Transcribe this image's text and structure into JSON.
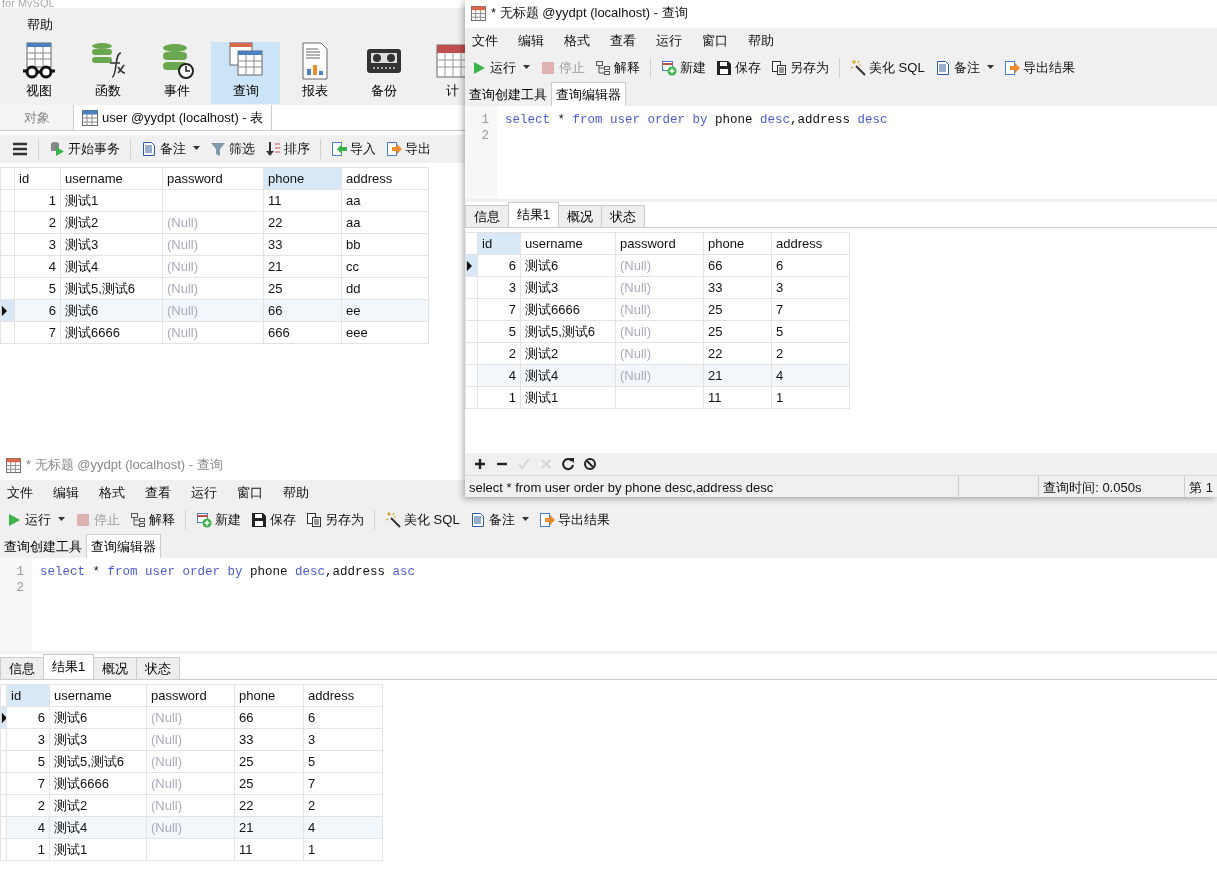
{
  "main_window": {
    "title": "for MySQL",
    "menu": [
      "帮助"
    ],
    "ribbon": [
      {
        "label": "视图",
        "kind": "view",
        "selected": false
      },
      {
        "label": "函数",
        "kind": "function",
        "selected": false
      },
      {
        "label": "事件",
        "kind": "event",
        "selected": false
      },
      {
        "label": "查询",
        "kind": "query",
        "selected": true
      },
      {
        "label": "报表",
        "kind": "report",
        "selected": false
      },
      {
        "label": "备份",
        "kind": "backup",
        "selected": false
      },
      {
        "label": "计",
        "kind": "schedule",
        "selected": false
      }
    ],
    "tabs": [
      {
        "label": "对象",
        "selected": false
      },
      {
        "label": "user @yydpt (localhost) - 表",
        "selected": true
      }
    ],
    "toolbar_groups": [
      [
        {
          "kind": "menu",
          "dropdown": false
        }
      ],
      [
        {
          "label": "开始事务",
          "kind": "transaction",
          "dropdown": false
        }
      ],
      [
        {
          "label": "备注",
          "kind": "note",
          "dropdown": true
        },
        {
          "label": "筛选",
          "kind": "filter",
          "dropdown": false
        },
        {
          "label": "排序",
          "kind": "sort",
          "dropdown": false
        }
      ],
      [
        {
          "label": "导入",
          "kind": "import",
          "dropdown": false
        },
        {
          "label": "导出",
          "kind": "export",
          "dropdown": false
        }
      ]
    ],
    "table": {
      "columns": [
        {
          "label": "id",
          "selected": false
        },
        {
          "label": "username",
          "selected": false
        },
        {
          "label": "password",
          "selected": false
        },
        {
          "label": "phone",
          "selected": true
        },
        {
          "label": "address",
          "selected": false
        }
      ],
      "rows": [
        {
          "selected": false,
          "highlighted": false,
          "cells": [
            "1",
            "测试1",
            null,
            "11",
            "aa"
          ]
        },
        {
          "selected": false,
          "highlighted": false,
          "cells": [
            "2",
            "测试2",
            {
              "text": "(Null)",
              "kind": "null"
            },
            "22",
            "aa"
          ]
        },
        {
          "selected": false,
          "highlighted": false,
          "cells": [
            "3",
            "测试3",
            {
              "text": "(Null)",
              "kind": "null"
            },
            "33",
            "bb"
          ]
        },
        {
          "selected": false,
          "highlighted": false,
          "cells": [
            "4",
            "测试4",
            {
              "text": "(Null)",
              "kind": "null"
            },
            "21",
            "cc"
          ]
        },
        {
          "selected": false,
          "highlighted": false,
          "cells": [
            "5",
            "测试5,测试6",
            {
              "text": "(Null)",
              "kind": "null"
            },
            "25",
            "dd"
          ]
        },
        {
          "selected": true,
          "highlighted": true,
          "cells": [
            "6",
            "测试6",
            {
              "text": "(Null)",
              "kind": "null"
            },
            "66",
            "ee"
          ]
        },
        {
          "selected": false,
          "highlighted": false,
          "cells": [
            "7",
            "测试6666",
            {
              "text": "(Null)",
              "kind": "null"
            },
            "666",
            "eee"
          ]
        }
      ]
    }
  },
  "query_windows": [
    {
      "title": "* 无标题 @yydpt (localhost) - 查询",
      "active": true,
      "menu": [
        "文件",
        "编辑",
        "格式",
        "查看",
        "运行",
        "窗口",
        "帮助"
      ],
      "toolbar_groups": [
        [
          {
            "label": "运行",
            "kind": "play",
            "dropdown": true,
            "disabled": false
          },
          {
            "label": "停止",
            "kind": "stop",
            "dropdown": false,
            "disabled": true
          },
          {
            "label": "解释",
            "kind": "explain",
            "dropdown": false,
            "disabled": false
          }
        ],
        [
          {
            "label": "新建",
            "kind": "new",
            "dropdown": false,
            "disabled": false
          },
          {
            "label": "保存",
            "kind": "save",
            "dropdown": false,
            "disabled": false
          },
          {
            "label": "另存为",
            "kind": "saveas",
            "dropdown": false,
            "disabled": false
          }
        ],
        [
          {
            "label": "美化 SQL",
            "kind": "beautify",
            "dropdown": false,
            "disabled": false
          },
          {
            "label": "备注",
            "kind": "note",
            "dropdown": true,
            "disabled": false
          },
          {
            "label": "导出结果",
            "kind": "export",
            "dropdown": false,
            "disabled": false
          }
        ]
      ],
      "editor_tabs": [
        {
          "label": "查询创建工具",
          "selected": false
        },
        {
          "label": "查询编辑器",
          "selected": true
        }
      ],
      "sql_lines": [
        {
          "number": "1",
          "tokens": [
            {
              "text": "select",
              "kind": "keyword"
            },
            {
              "text": " * ",
              "kind": "plain"
            },
            {
              "text": "from user order by",
              "kind": "keyword"
            },
            {
              "text": " phone ",
              "kind": "plain"
            },
            {
              "text": "desc",
              "kind": "keyword"
            },
            {
              "text": ",address ",
              "kind": "plain"
            },
            {
              "text": "desc",
              "kind": "keyword"
            }
          ]
        },
        {
          "number": "2"
        }
      ],
      "result_tabs": [
        {
          "label": "信息",
          "selected": false
        },
        {
          "label": "结果1",
          "selected": true
        },
        {
          "label": "概况",
          "selected": false
        },
        {
          "label": "状态",
          "selected": false
        }
      ],
      "table": {
        "columns": [
          {
            "label": "id",
            "selected": true
          },
          {
            "label": "username",
            "selected": false
          },
          {
            "label": "password",
            "selected": false
          },
          {
            "label": "phone",
            "selected": false
          },
          {
            "label": "address",
            "selected": false
          }
        ],
        "rows": [
          {
            "selected": true,
            "highlighted": false,
            "cells": [
              "6",
              "测试6",
              {
                "text": "(Null)",
                "kind": "null"
              },
              "66",
              "6"
            ]
          },
          {
            "selected": false,
            "highlighted": false,
            "cells": [
              "3",
              "测试3",
              {
                "text": "(Null)",
                "kind": "null"
              },
              "33",
              "3"
            ]
          },
          {
            "selected": false,
            "highlighted": false,
            "cells": [
              "7",
              "测试6666",
              {
                "text": "(Null)",
                "kind": "null"
              },
              "25",
              "7"
            ]
          },
          {
            "selected": false,
            "highlighted": false,
            "cells": [
              "5",
              "测试5,测试6",
              {
                "text": "(Null)",
                "kind": "null"
              },
              "25",
              "5"
            ]
          },
          {
            "selected": false,
            "highlighted": false,
            "cells": [
              "2",
              "测试2",
              {
                "text": "(Null)",
                "kind": "null"
              },
              "22",
              "2"
            ]
          },
          {
            "selected": false,
            "highlighted": true,
            "cells": [
              "4",
              "测试4",
              {
                "text": "(Null)",
                "kind": "null"
              },
              "21",
              "4"
            ]
          },
          {
            "selected": false,
            "highlighted": false,
            "cells": [
              "1",
              "测试1",
              null,
              "11",
              "1"
            ]
          }
        ]
      },
      "grid_tools": [
        {
          "kind": "add",
          "disabled": false
        },
        {
          "kind": "remove",
          "disabled": false
        },
        {
          "kind": "apply",
          "disabled": true
        },
        {
          "kind": "discard",
          "disabled": true
        },
        {
          "kind": "refresh",
          "disabled": false
        },
        {
          "kind": "stop",
          "disabled": false
        }
      ],
      "status_bar": {
        "sql": "select * from user order by phone desc,address desc",
        "segments": [
          "查询时间: 0.050s",
          "第 1"
        ]
      }
    },
    {
      "title": "* 无标题 @yydpt (localhost) - 查询",
      "active": false,
      "menu": [
        "文件",
        "编辑",
        "格式",
        "查看",
        "运行",
        "窗口",
        "帮助"
      ],
      "toolbar_groups": [
        [
          {
            "label": "运行",
            "kind": "play",
            "dropdown": true,
            "disabled": false
          },
          {
            "label": "停止",
            "kind": "stop",
            "dropdown": false,
            "disabled": true
          },
          {
            "label": "解释",
            "kind": "explain",
            "dropdown": false,
            "disabled": false
          }
        ],
        [
          {
            "label": "新建",
            "kind": "new",
            "dropdown": false,
            "disabled": false
          },
          {
            "label": "保存",
            "kind": "save",
            "dropdown": false,
            "disabled": false
          },
          {
            "label": "另存为",
            "kind": "saveas",
            "dropdown": false,
            "disabled": false
          }
        ],
        [
          {
            "label": "美化 SQL",
            "kind": "beautify",
            "dropdown": false,
            "disabled": false
          },
          {
            "label": "备注",
            "kind": "note",
            "dropdown": true,
            "disabled": false
          },
          {
            "label": "导出结果",
            "kind": "export",
            "dropdown": false,
            "disabled": false
          }
        ]
      ],
      "editor_tabs": [
        {
          "label": "查询创建工具",
          "selected": false
        },
        {
          "label": "查询编辑器",
          "selected": true
        }
      ],
      "sql_lines": [
        {
          "number": "1",
          "tokens": [
            {
              "text": "select",
              "kind": "keyword"
            },
            {
              "text": " * ",
              "kind": "plain"
            },
            {
              "text": "from user order by",
              "kind": "keyword"
            },
            {
              "text": " phone ",
              "kind": "plain"
            },
            {
              "text": "desc",
              "kind": "keyword"
            },
            {
              "text": ",address ",
              "kind": "plain"
            },
            {
              "text": "asc",
              "kind": "keyword"
            }
          ]
        },
        {
          "number": "2"
        }
      ],
      "result_tabs": [
        {
          "label": "信息",
          "selected": false
        },
        {
          "label": "结果1",
          "selected": true
        },
        {
          "label": "概况",
          "selected": false
        },
        {
          "label": "状态",
          "selected": false
        }
      ],
      "table": {
        "columns": [
          {
            "label": "id",
            "selected": true
          },
          {
            "label": "username",
            "selected": false
          },
          {
            "label": "password",
            "selected": false
          },
          {
            "label": "phone",
            "selected": false
          },
          {
            "label": "address",
            "selected": false
          }
        ],
        "rows": [
          {
            "selected": true,
            "highlighted": false,
            "cells": [
              "6",
              "测试6",
              {
                "text": "(Null)",
                "kind": "null"
              },
              "66",
              "6"
            ]
          },
          {
            "selected": false,
            "highlighted": false,
            "cells": [
              "3",
              "测试3",
              {
                "text": "(Null)",
                "kind": "null"
              },
              "33",
              "3"
            ]
          },
          {
            "selected": false,
            "highlighted": false,
            "cells": [
              "5",
              "测试5,测试6",
              {
                "text": "(Null)",
                "kind": "null"
              },
              "25",
              "5"
            ]
          },
          {
            "selected": false,
            "highlighted": false,
            "cells": [
              "7",
              "测试6666",
              {
                "text": "(Null)",
                "kind": "null"
              },
              "25",
              "7"
            ]
          },
          {
            "selected": false,
            "highlighted": false,
            "cells": [
              "2",
              "测试2",
              {
                "text": "(Null)",
                "kind": "null"
              },
              "22",
              "2"
            ]
          },
          {
            "selected": false,
            "highlighted": true,
            "cells": [
              "4",
              "测试4",
              {
                "text": "(Null)",
                "kind": "null"
              },
              "21",
              "4"
            ]
          },
          {
            "selected": false,
            "highlighted": false,
            "cells": [
              "1",
              "测试1",
              null,
              "11",
              "1"
            ]
          }
        ]
      }
    }
  ]
}
